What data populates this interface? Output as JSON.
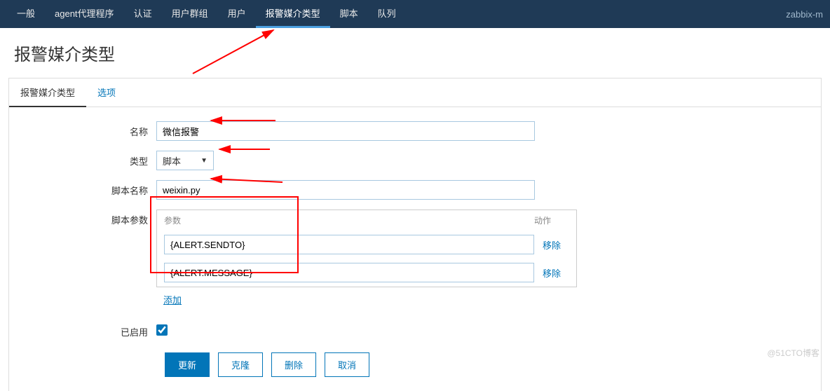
{
  "nav": {
    "items": [
      {
        "label": "一般"
      },
      {
        "label": "agent代理程序"
      },
      {
        "label": "认证"
      },
      {
        "label": "用户群组"
      },
      {
        "label": "用户"
      },
      {
        "label": "报警媒介类型"
      },
      {
        "label": "脚本"
      },
      {
        "label": "队列"
      }
    ],
    "right": "zabbix-m"
  },
  "page": {
    "title": "报警媒介类型"
  },
  "tabs": {
    "items": [
      {
        "label": "报警媒介类型"
      },
      {
        "label": "选项"
      }
    ]
  },
  "form": {
    "name_label": "名称",
    "name_value": "微信报警",
    "type_label": "类型",
    "type_value": "脚本",
    "script_name_label": "脚本名称",
    "script_name_value": "weixin.py",
    "script_params_label": "脚本参数",
    "params_header_param": "参数",
    "params_header_action": "动作",
    "params": [
      {
        "value": "{ALERT.SENDTO}",
        "remove": "移除"
      },
      {
        "value": "{ALERT.MESSAGE}",
        "remove": "移除"
      }
    ],
    "add_label": "添加",
    "enabled_label": "已启用",
    "enabled_checked": true
  },
  "buttons": {
    "update": "更新",
    "clone": "克隆",
    "delete": "删除",
    "cancel": "取消"
  },
  "watermark": "@51CTO博客"
}
